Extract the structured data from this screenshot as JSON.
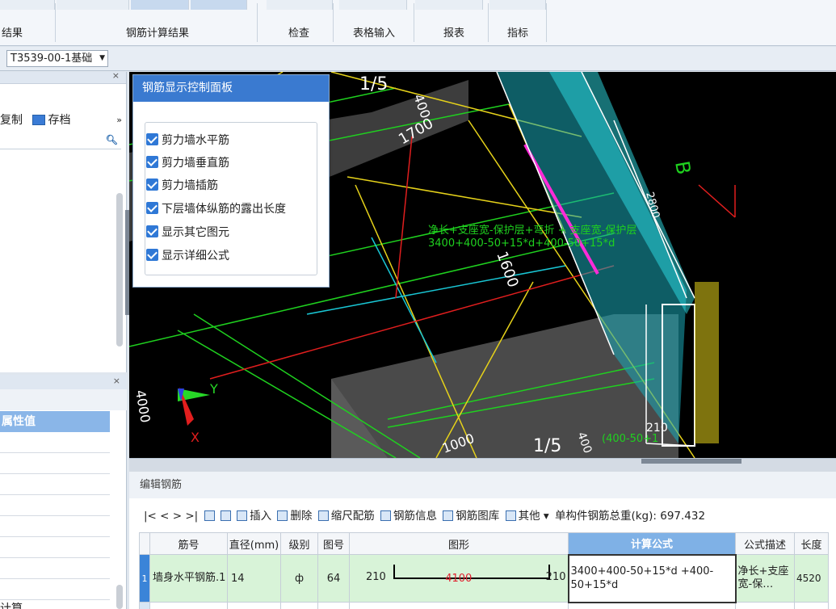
{
  "ribbon": {
    "groups": [
      {
        "label": "结果"
      },
      {
        "label": "钢筋计算结果"
      },
      {
        "label": "检查"
      },
      {
        "label": "表格输入"
      },
      {
        "label": "报表"
      },
      {
        "label": "指标"
      }
    ]
  },
  "toolbar": {
    "floor_combo": "T3539-00-1基础"
  },
  "left_panel": {
    "copy_label": "复制",
    "archive_label": "存档",
    "more": "»",
    "prop_header": "属性值",
    "bottom_text": "计算"
  },
  "viewport": {
    "labels": [
      "1/5",
      "400",
      "1700",
      "1600",
      "2800",
      "1000",
      "1/5",
      "400",
      "210",
      "(400-50+1",
      "B",
      "1000"
    ],
    "formula_text_1": "净长+支座宽-保护层+弯折 + 支座宽-保护层",
    "formula_text_2": "3400+400-50+15*d+400-50+15*d",
    "axis_left_label": "4000",
    "axis_x": "X",
    "axis_y": "Y"
  },
  "control_panel": {
    "title": "钢筋显示控制面板",
    "items": [
      {
        "label": "剪力墙水平筋",
        "checked": true
      },
      {
        "label": "剪力墙垂直筋",
        "checked": true
      },
      {
        "label": "剪力墙插筋",
        "checked": true
      },
      {
        "label": "下层墙体纵筋的露出长度",
        "checked": true
      },
      {
        "label": "显示其它图元",
        "checked": true
      },
      {
        "label": "显示详细公式",
        "checked": true
      }
    ]
  },
  "edit_rebar": {
    "title": "编辑钢筋",
    "nav": "|< < > >|",
    "insert": "插入",
    "delete": "删除",
    "scale": "缩尺配筋",
    "info": "钢筋信息",
    "library": "钢筋图库",
    "other": "其他 ▾",
    "total_weight": "单构件钢筋总重(kg): 697.432",
    "columns": [
      "筋号",
      "直径(mm)",
      "级别",
      "图号",
      "图形",
      "计算公式",
      "公式描述",
      "长度"
    ],
    "rows": [
      {
        "index": "1",
        "name": "墙身水平钢筋.1",
        "diameter": "14",
        "grade": "ф",
        "figure": "64",
        "shape_left": "210",
        "shape_mid": "4100",
        "shape_right": "210",
        "formula": "3400+400-50+15*d +400-50+15*d",
        "desc": "净长+支座宽-保…",
        "length": "4520"
      }
    ]
  }
}
